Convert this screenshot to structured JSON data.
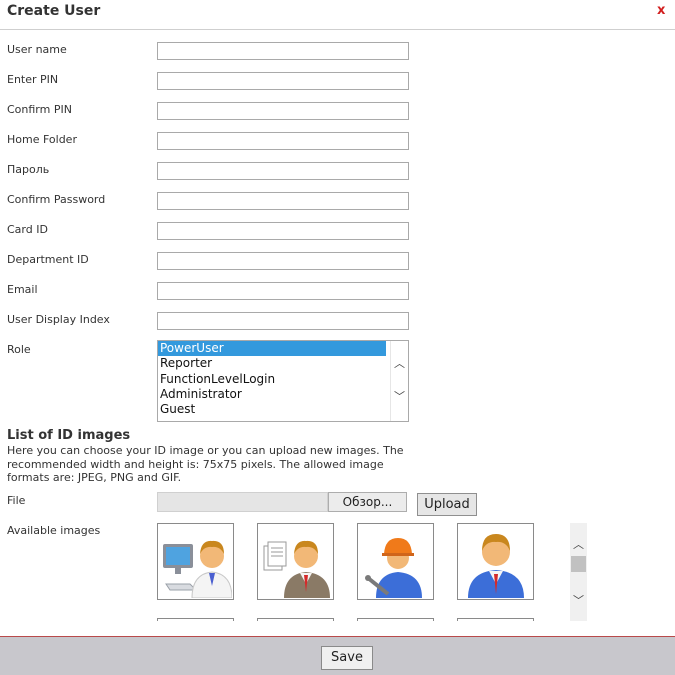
{
  "dialog": {
    "title": "Create User",
    "close_glyph": "x"
  },
  "fields": [
    {
      "label": "User name",
      "value": ""
    },
    {
      "label": "Enter PIN",
      "value": ""
    },
    {
      "label": "Confirm PIN",
      "value": ""
    },
    {
      "label": "Home Folder",
      "value": ""
    },
    {
      "label": "Пароль",
      "value": ""
    },
    {
      "label": "Confirm Password",
      "value": ""
    },
    {
      "label": "Card ID",
      "value": ""
    },
    {
      "label": "Department ID",
      "value": ""
    },
    {
      "label": "Email",
      "value": ""
    },
    {
      "label": "User Display Index",
      "value": ""
    }
  ],
  "role": {
    "label": "Role",
    "options": [
      "PowerUser",
      "Reporter",
      "FunctionLevelLogin",
      "Administrator",
      "Guest"
    ],
    "selected": "PowerUser"
  },
  "images_section": {
    "heading": "List of ID images",
    "help": "Here you can choose your ID image or you can upload new images. The recommended width and height is: 75x75 pixels. The allowed image formats are: JPEG, PNG and GIF.",
    "file_label": "File",
    "browse_label": "Обзор...",
    "upload_label": "Upload",
    "available_label": "Available images",
    "icons": [
      "computer-user-icon",
      "documents-user-icon",
      "worker-helmet-icon",
      "manager-user-icon"
    ],
    "colors": {
      "skin": "#f2b877",
      "hair": "#c9871e",
      "shirt_blue": "#3c6ed8",
      "helmet": "#f07a1a",
      "tie": "#d42a2a"
    }
  },
  "footer": {
    "save_label": "Save"
  },
  "colors": {
    "accent": "#3399dd",
    "close": "#d21f1f",
    "footer_bg": "#c8c7cc"
  }
}
